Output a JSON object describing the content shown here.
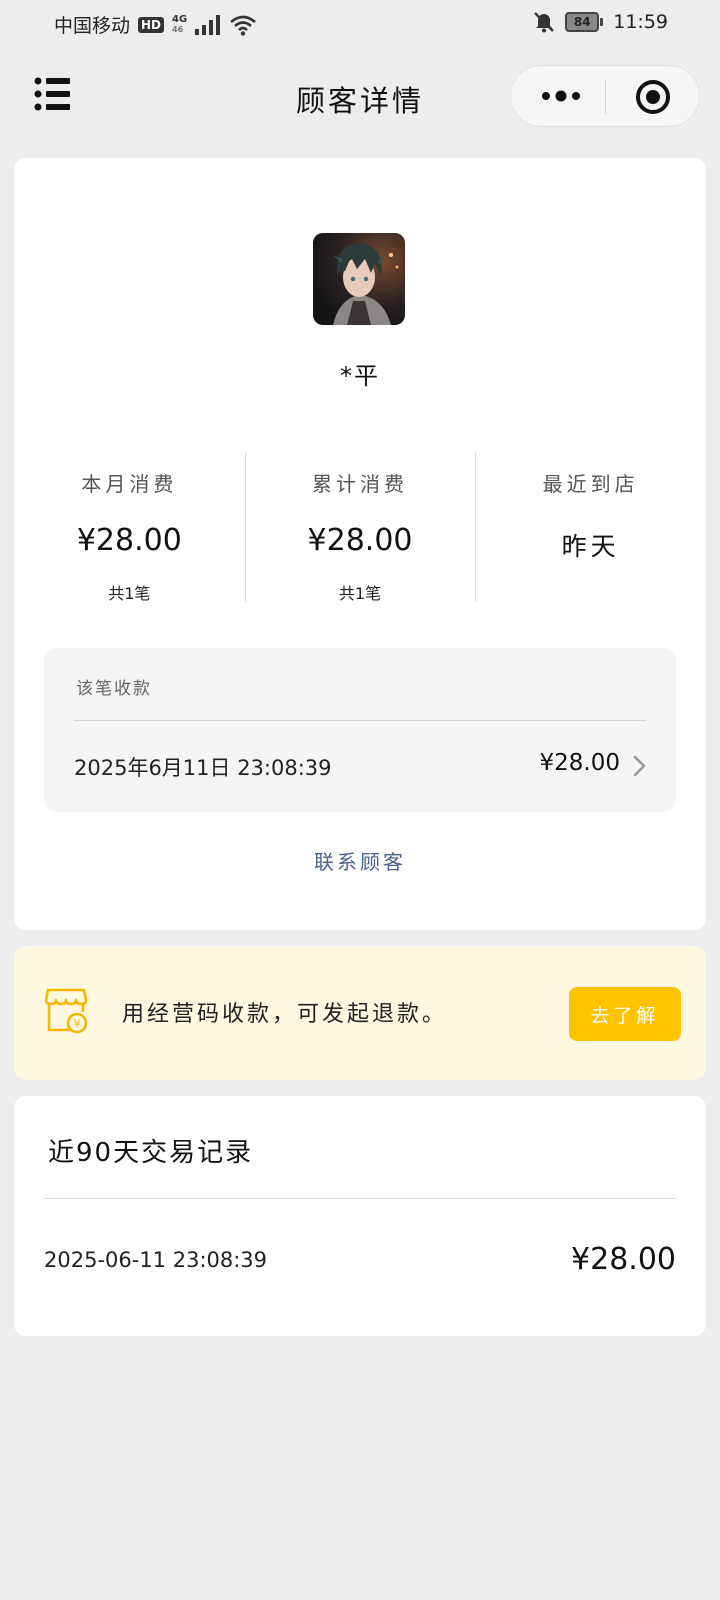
{
  "status_bar": {
    "carrier": "中国移动",
    "hd": "HD",
    "network_top": "4G",
    "network_bottom": "46",
    "battery": "84",
    "time": "11:59"
  },
  "nav": {
    "title": "顾客详情"
  },
  "customer": {
    "name": "*平",
    "stats": [
      {
        "label": "本月消费",
        "value": "¥28.00",
        "sub": "共1笔"
      },
      {
        "label": "累计消费",
        "value": "¥28.00",
        "sub": "共1笔"
      },
      {
        "label": "最近到店",
        "value": "昨天",
        "sub": ""
      }
    ],
    "receipt": {
      "label": "该笔收款",
      "time": "2025年6月11日 23:08:39",
      "amount": "¥28.00"
    },
    "contact": "联系顾客"
  },
  "banner": {
    "text": "用经营码收款，可发起退款。",
    "button": "去了解",
    "accent": "#ffc300"
  },
  "transactions": {
    "title": "近90天交易记录",
    "items": [
      {
        "time": "2025-06-11 23:08:39",
        "amount": "¥28.00"
      }
    ]
  }
}
